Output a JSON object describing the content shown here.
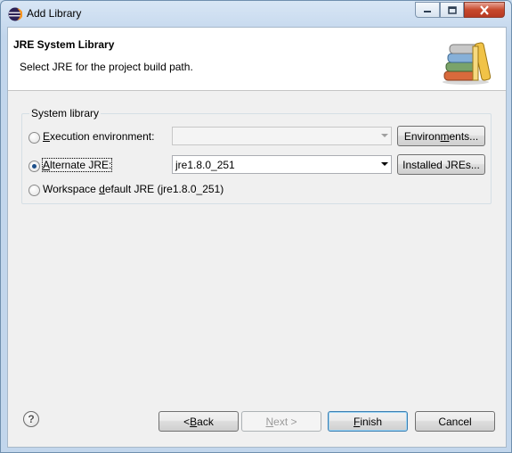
{
  "window": {
    "title": "Add Library"
  },
  "header": {
    "title": "JRE System Library",
    "subtitle": "Select JRE for the project build path."
  },
  "group": {
    "label": "System library",
    "options": [
      {
        "pre": "",
        "mn": "E",
        "post": "xecution environment:",
        "checked": false
      },
      {
        "pre": "",
        "mn": "A",
        "post": "lternate JRE:",
        "checked": true
      },
      {
        "pre": "Workspace ",
        "mn": "d",
        "post": "efault JRE (jre1.8.0_251)",
        "checked": false
      }
    ],
    "execution_env_value": "",
    "alternate_jre_value": "jre1.8.0_251",
    "environments_button": {
      "pre": "Environ",
      "mn": "m",
      "post": "ents..."
    },
    "installed_jres_button": {
      "pre": "Installed JREs...",
      "mn": "",
      "post": ""
    }
  },
  "buttons": {
    "help": "?",
    "back": {
      "pre": "< ",
      "mn": "B",
      "post": "ack"
    },
    "next": {
      "pre": "",
      "mn": "N",
      "post": "ext >"
    },
    "finish": {
      "pre": "",
      "mn": "F",
      "post": "inish"
    },
    "cancel": "Cancel"
  },
  "colors": {
    "title_bg": "#c9dcef",
    "dialog_bg": "#f0f0f0",
    "close_button": "#c7482c"
  }
}
